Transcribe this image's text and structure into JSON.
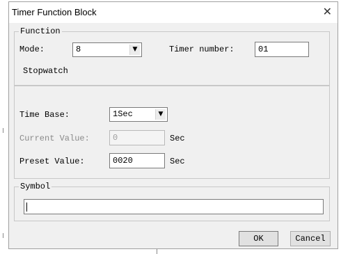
{
  "window": {
    "title": "Timer Function Block",
    "close_glyph": "✕"
  },
  "function_group": {
    "legend": "Function",
    "mode_label": "Mode:",
    "mode_value": "8",
    "timer_number_label": "Timer number:",
    "timer_number_value": "01",
    "mode_description": "Stopwatch"
  },
  "timing": {
    "time_base_label": "Time Base:",
    "time_base_value": "1Sec",
    "current_value_label": "Current Value:",
    "current_value": "0",
    "current_unit": "Sec",
    "preset_value_label": "Preset Value:",
    "preset_value": "0020",
    "preset_unit": "Sec"
  },
  "symbol_group": {
    "legend": "Symbol",
    "value": ""
  },
  "buttons": {
    "ok_label": "OK",
    "cancel_label": "Cancel"
  },
  "icons": {
    "close": "close-icon",
    "dropdown": "chevron-down-icon"
  }
}
